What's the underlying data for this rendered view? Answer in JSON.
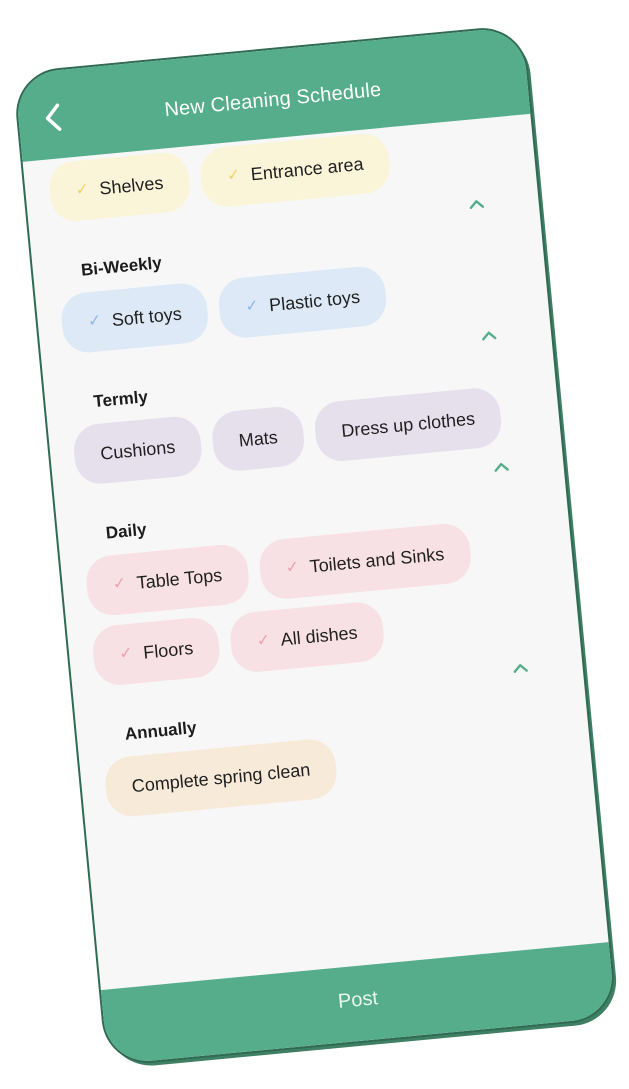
{
  "header": {
    "title": "New Cleaning Schedule",
    "back_icon": "chevron-left-icon"
  },
  "sections": [
    {
      "title": "",
      "collapse_icon": "chevron-up-icon",
      "color": "#faf5d9",
      "items": [
        {
          "label": "Shelves",
          "checked": true
        },
        {
          "label": "Entrance area",
          "checked": true
        }
      ]
    },
    {
      "title": "Bi-Weekly",
      "collapse_icon": "chevron-up-icon",
      "color": "#dde9f6",
      "items": [
        {
          "label": "Soft toys",
          "checked": true
        },
        {
          "label": "Plastic toys",
          "checked": true
        }
      ]
    },
    {
      "title": "Termly",
      "collapse_icon": "chevron-up-icon",
      "color": "#e6e0ec",
      "items": [
        {
          "label": "Cushions",
          "checked": false
        },
        {
          "label": "Mats",
          "checked": false
        },
        {
          "label": "Dress up clothes",
          "checked": false
        }
      ]
    },
    {
      "title": "Daily",
      "collapse_icon": "chevron-up-icon",
      "color": "#f8e1e4",
      "items": [
        {
          "label": "Table Tops",
          "checked": true
        },
        {
          "label": "Toilets and Sinks",
          "checked": true
        },
        {
          "label": "Floors",
          "checked": true
        },
        {
          "label": "All dishes",
          "checked": true
        }
      ]
    },
    {
      "title": "Annually",
      "collapse_icon": "chevron-up-icon",
      "color": "#f7ead9",
      "items": [
        {
          "label": "Complete spring clean",
          "checked": false
        }
      ]
    }
  ],
  "footer": {
    "post_label": "Post"
  },
  "colors": {
    "accent": "#55ad8b",
    "check_mark": "✓"
  }
}
